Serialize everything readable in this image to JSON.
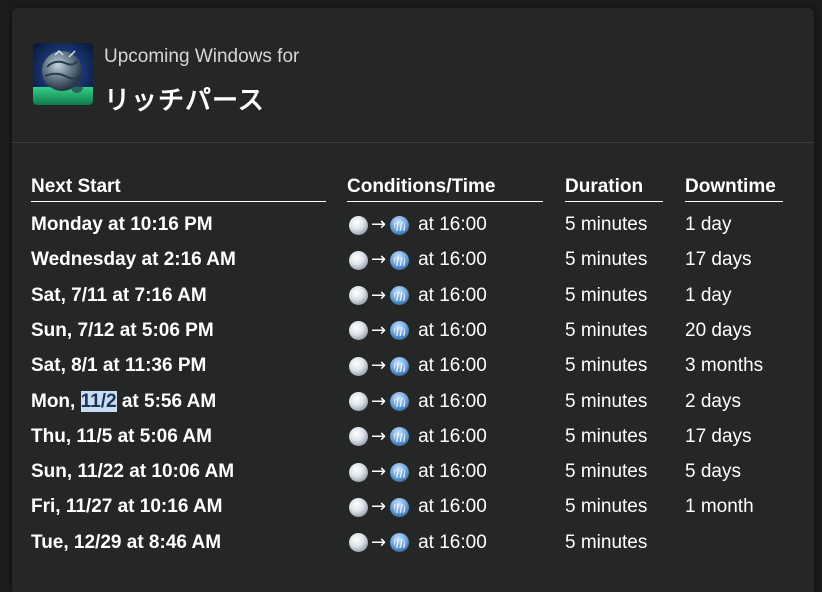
{
  "header": {
    "subtitle": "Upcoming Windows for",
    "title": "リッチパース",
    "icon": "zone-globe-icon"
  },
  "columns": {
    "next_start": "Next Start",
    "conditions": "Conditions/Time",
    "duration": "Duration",
    "downtime": "Downtime"
  },
  "condition_icons": {
    "from": "clouds-weather-icon",
    "to": "rain-weather-icon",
    "arrow": "→"
  },
  "rows": [
    {
      "next_pre": "Monday at 10:16 PM",
      "next_hl": "",
      "next_post": "",
      "time": "at 16:00",
      "duration": "5 minutes",
      "downtime": "1 day"
    },
    {
      "next_pre": "Wednesday at 2:16 AM",
      "next_hl": "",
      "next_post": "",
      "time": "at 16:00",
      "duration": "5 minutes",
      "downtime": "17 days"
    },
    {
      "next_pre": "Sat, 7/11 at 7:16 AM",
      "next_hl": "",
      "next_post": "",
      "time": "at 16:00",
      "duration": "5 minutes",
      "downtime": "1 day"
    },
    {
      "next_pre": "Sun, 7/12 at 5:06 PM",
      "next_hl": "",
      "next_post": "",
      "time": "at 16:00",
      "duration": "5 minutes",
      "downtime": "20 days"
    },
    {
      "next_pre": "Sat, 8/1 at 11:36 PM",
      "next_hl": "",
      "next_post": "",
      "time": "at 16:00",
      "duration": "5 minutes",
      "downtime": "3 months"
    },
    {
      "next_pre": "Mon, ",
      "next_hl": "11/2",
      "next_post": " at 5:56 AM",
      "time": "at 16:00",
      "duration": "5 minutes",
      "downtime": "2 days"
    },
    {
      "next_pre": "Thu, 11/5 at 5:06 AM",
      "next_hl": "",
      "next_post": "",
      "time": "at 16:00",
      "duration": "5 minutes",
      "downtime": "17 days"
    },
    {
      "next_pre": "Sun, 11/22 at 10:06 AM",
      "next_hl": "",
      "next_post": "",
      "time": "at 16:00",
      "duration": "5 minutes",
      "downtime": "5 days"
    },
    {
      "next_pre": "Fri, 11/27 at 10:16 AM",
      "next_hl": "",
      "next_post": "",
      "time": "at 16:00",
      "duration": "5 minutes",
      "downtime": "1 month"
    },
    {
      "next_pre": "Tue, 12/29 at 8:46 AM",
      "next_hl": "",
      "next_post": "",
      "time": "at 16:00",
      "duration": "5 minutes",
      "downtime": ""
    }
  ]
}
